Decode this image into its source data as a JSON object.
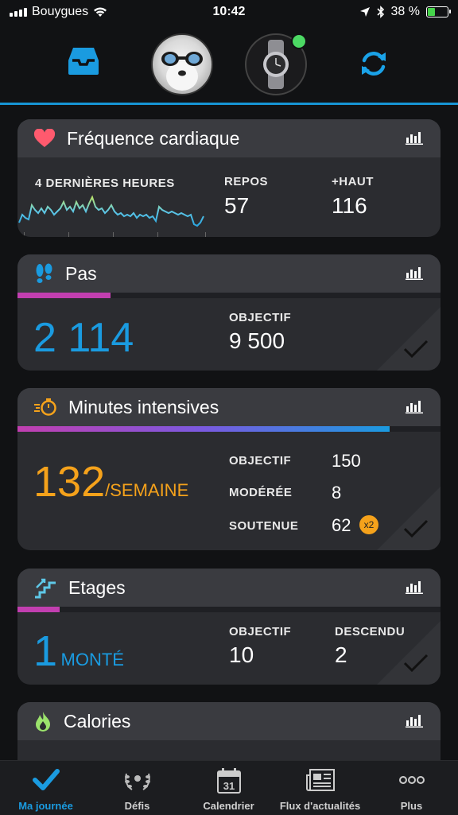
{
  "status": {
    "carrier": "Bouygues",
    "time": "10:42",
    "battery": "38 %"
  },
  "heart": {
    "title": "Fréquence cardiaque",
    "period_label": "4 DERNIÈRES HEURES",
    "rest_label": "REPOS",
    "rest_value": "57",
    "high_label": "+HAUT",
    "high_value": "116"
  },
  "steps": {
    "title": "Pas",
    "value": "2 114",
    "goal_label": "OBJECTIF",
    "goal_value": "9 500",
    "progress": 0.22
  },
  "intensity": {
    "title": "Minutes intensives",
    "value": "132",
    "unit": "/SEMAINE",
    "goal_label": "OBJECTIF",
    "goal_value": "150",
    "moderate_label": "MODÉRÉE",
    "moderate_value": "8",
    "vigorous_label": "SOUTENUE",
    "vigorous_value": "62",
    "vigorous_badge": "x2",
    "progress": 0.88
  },
  "floors": {
    "title": "Etages",
    "value": "1",
    "unit": "MONTÉ",
    "goal_label": "OBJECTIF",
    "goal_value": "10",
    "down_label": "DESCENDU",
    "down_value": "2",
    "progress": 0.1
  },
  "calories": {
    "title": "Calories"
  },
  "tabs": [
    {
      "label": "Ma journée",
      "icon": "check-icon"
    },
    {
      "label": "Défis",
      "icon": "laurel-icon"
    },
    {
      "label": "Calendrier",
      "icon": "calendar-icon",
      "day": "31"
    },
    {
      "label": "Flux d'actualités",
      "icon": "news-icon"
    },
    {
      "label": "Plus",
      "icon": "more-icon"
    }
  ],
  "colors": {
    "accent": "#1a9be0",
    "steps_blue": "#1a9be0",
    "intensity_orange": "#f5a21b",
    "heart_red": "#ff5a6e",
    "sync_blue": "#1aa2e8"
  }
}
